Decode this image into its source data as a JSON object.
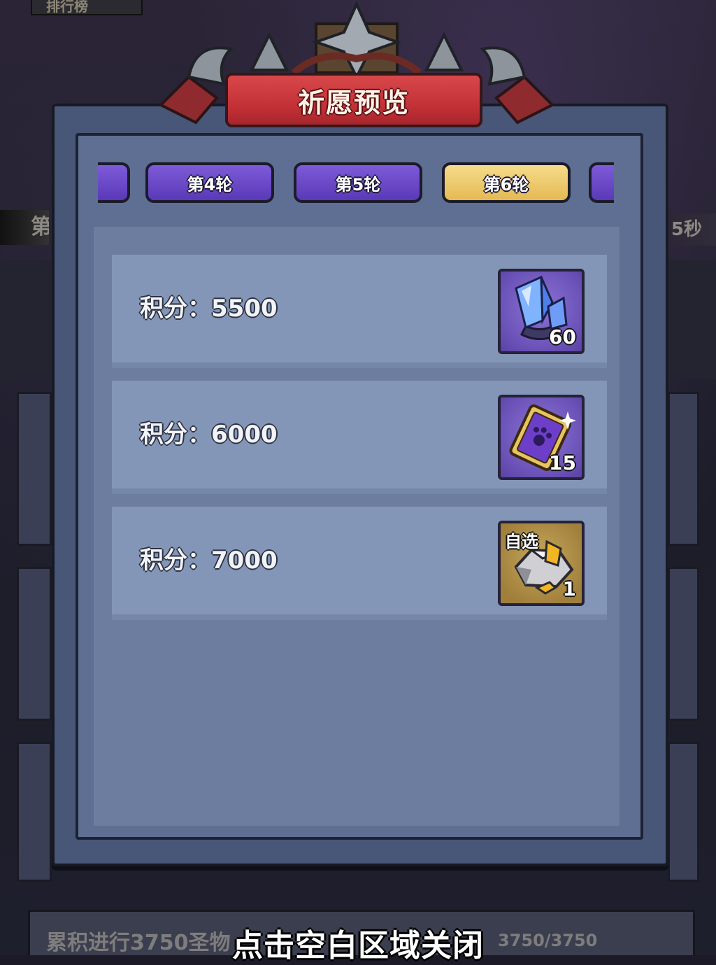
{
  "background": {
    "top_label": "排行榜",
    "left_text": "第",
    "right_text": "5秒",
    "bottom_left": "累积进行3750圣物",
    "bottom_right": "3750/3750"
  },
  "dialog": {
    "title": "祈愿预览",
    "tabs": [
      {
        "label": "第4轮",
        "selected": false
      },
      {
        "label": "第5轮",
        "selected": false
      },
      {
        "label": "第6轮",
        "selected": true
      }
    ],
    "rewards": [
      {
        "label": "积分：5500",
        "item": "crystal-shard-icon",
        "count": "60"
      },
      {
        "label": "积分：6000",
        "item": "paw-ticket-icon",
        "count": "15"
      },
      {
        "label": "积分：7000",
        "item": "selectable-ore-icon",
        "count": "1",
        "tag": "自选"
      }
    ]
  },
  "close_hint": "点击空白区域关闭",
  "colors": {
    "banner_red": "#c33237",
    "tab_purple": "#5a39b8",
    "tab_gold": "#e4b954",
    "panel_blue": "#5f6f93",
    "row_blue": "#8496b7"
  }
}
